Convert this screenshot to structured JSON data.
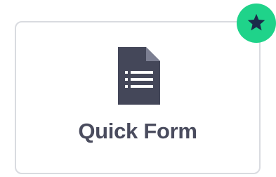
{
  "card": {
    "label": "Quick Form",
    "icon": "form-document-icon",
    "icon_color": "#444759",
    "border_color": "#d9dbe0",
    "label_color": "#4a4c5e"
  },
  "favorite_badge": {
    "icon": "star-icon",
    "active": true,
    "background_color": "#1fd38a",
    "icon_color": "#1b2a4a"
  }
}
